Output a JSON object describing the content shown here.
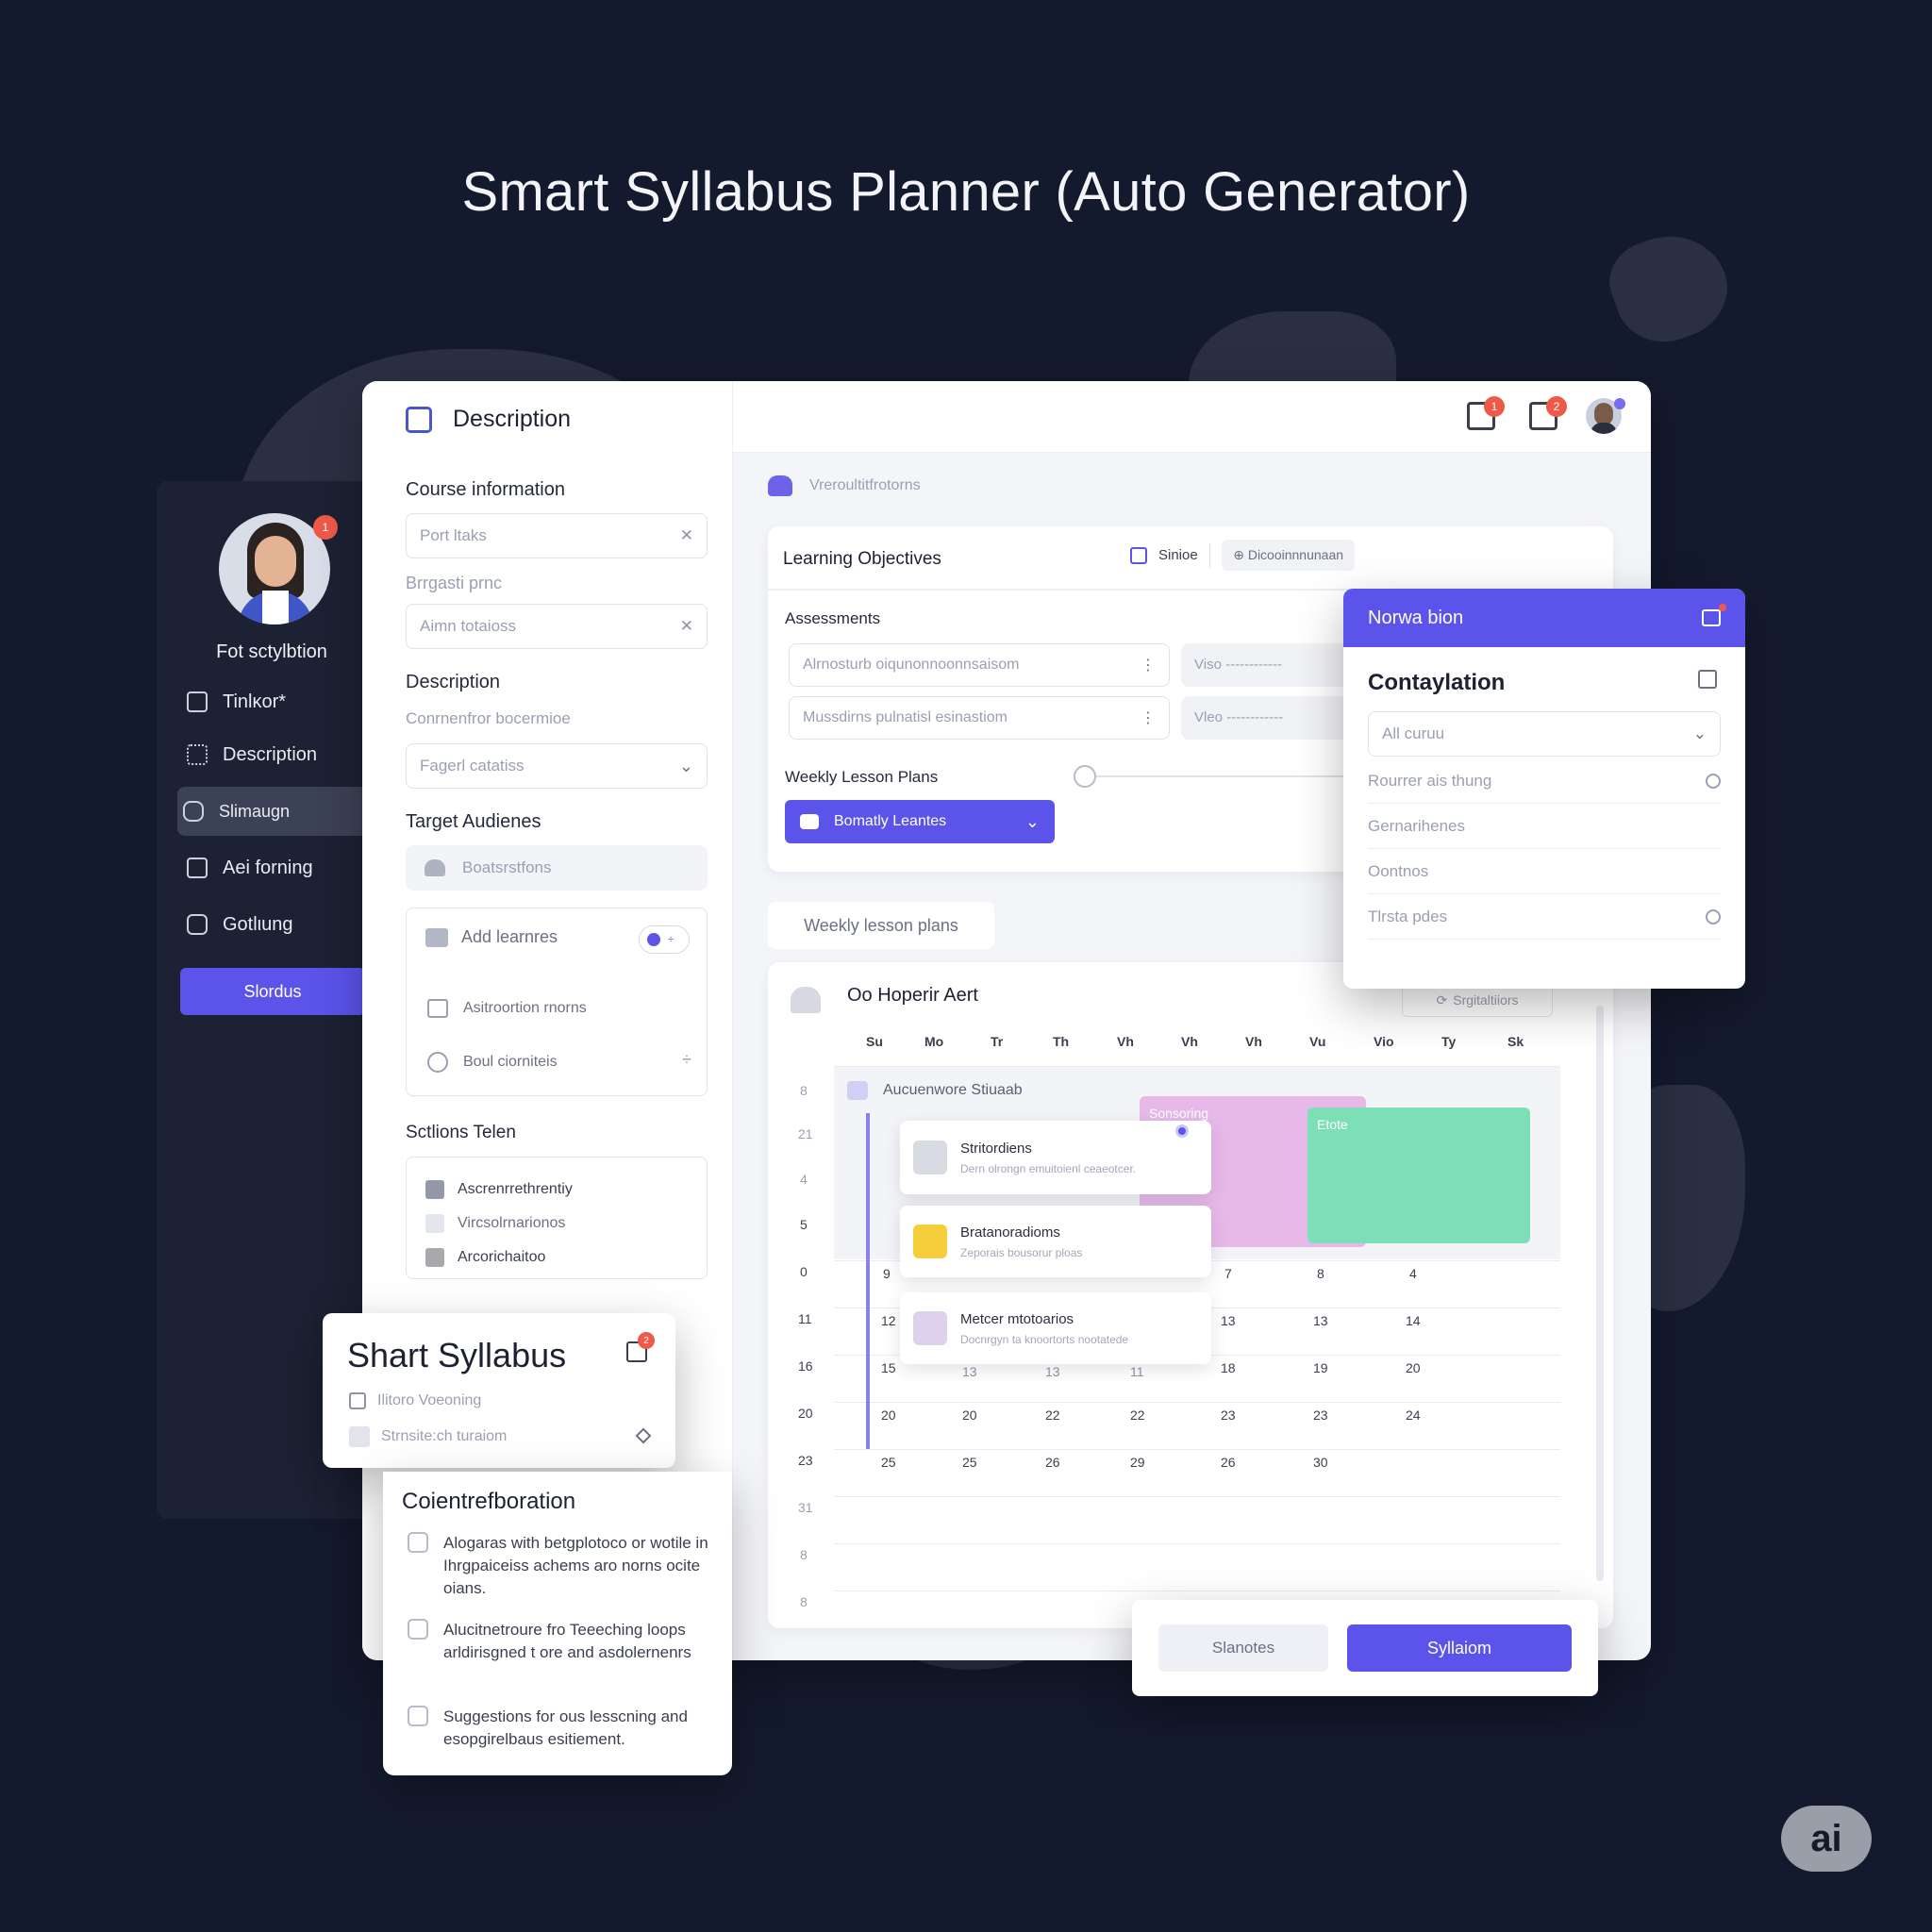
{
  "title": "Smart Syllabus Planner (Auto Generator)",
  "sidebar": {
    "user_name": "Fot sctylbtion",
    "items": [
      {
        "label": "Tinlκor*",
        "icon": "grid-icon"
      },
      {
        "label": "Description",
        "icon": "apps-icon"
      },
      {
        "label": "Slimaugn",
        "icon": "chat-icon"
      },
      {
        "label": "Aei forning",
        "icon": "briefcase-icon"
      },
      {
        "label": "Gotlιung",
        "icon": "camera-icon"
      }
    ],
    "button_label": "Slordus",
    "badge": "1"
  },
  "description_panel": {
    "header": "Description",
    "course_info_label": "Course information",
    "field1_placeholder": "Port ltaks",
    "sub_label": "Brrgasti prnc",
    "field2_placeholder": "Aimn totaioss",
    "description_label": "Description",
    "description_sub": "Conrnenfror bocermioe",
    "select_value": "Fagerl catatiss",
    "target_label": "Target Audienes",
    "target_item": "Boatsrstfons",
    "add_learners": "Add learnres",
    "action1": "Asitroortion rnorns",
    "action2": "Boul ciorniteis",
    "sections_label": "Sctlions Telen",
    "sections": [
      "Ascrenrrethrentiy",
      "Vircsolrnarionos",
      "Arcorichaitoo"
    ]
  },
  "shart_card": {
    "title": "Shart Syllabus",
    "item1": "Ilitoro Voeoning",
    "item2": "Strnsite:ch turaiom",
    "badge": "2"
  },
  "collab": {
    "title": "Coientrefboration",
    "items": [
      "Alogaras with betgplotoco or wotile in Ihrgpaiceiss achems aro norns ocite oians.",
      "Alucitnetroure fro Teeeching loops arldirisgned t ore and asdolernenrs",
      "Suggestions for ous lesscning and esopgirelbaus esitiement."
    ]
  },
  "topbar": {
    "badge1": "1",
    "badge2": "2"
  },
  "main": {
    "section_label": "Vreroultitfrotorns",
    "objectives_label": "Learning Objectives",
    "tool1": "Sinioe",
    "tool2": "Dicooinnnunaan",
    "assessments_label": "Assessments",
    "assess1": "Alrnosturb oiqunonnoonnsaisom",
    "assess2": "Mussdirns pulnatisl esinastiom",
    "view1": "Viso",
    "view2": "Vleo",
    "weekly_label": "Weekly Lesson Plans",
    "weekly_button": "Bomatly Leantes",
    "weekly_tab": "Weekly lesson plans"
  },
  "calendar": {
    "title": "Oo Hoperir Aert",
    "chip": "Srgitaltiiors",
    "days": [
      "Su",
      "Mo",
      "Tr",
      "Th",
      "Vh",
      "Vh",
      "Vh",
      "Vu",
      "Vio",
      "Ty",
      "Sk"
    ],
    "left_nums": [
      "8",
      "21",
      "4",
      "5",
      "0",
      "11",
      "16",
      "20",
      "23",
      "31",
      "8",
      "8"
    ],
    "banner": "Aucuenwore Stiuaab",
    "pink_label": "Sonsoring",
    "green_label": "Etote",
    "grid": [
      [
        "9",
        "7",
        "8",
        "4"
      ],
      [
        "12",
        "13",
        "13",
        "14"
      ],
      [
        "15",
        "18",
        "19",
        "20"
      ],
      [
        "20",
        "20",
        "22",
        "22",
        "23",
        "23",
        "24"
      ],
      [
        "25",
        "25",
        "26",
        "29",
        "26",
        "30"
      ]
    ],
    "grid_hidden": [
      "13",
      "13",
      "11"
    ],
    "events": [
      {
        "title": "Stritordiens",
        "sub": "Dern olrongn emuitoienl ceaeotcer.",
        "color": "#d9dbe3"
      },
      {
        "title": "Bratanoradioms",
        "sub": "Zeporais bousorur ploas",
        "color": "#f6cd3b"
      },
      {
        "title": "Metcer mtotoarios",
        "sub": "Docnrgyn ta knoortorts nootatede",
        "color": "#ddd1ee"
      }
    ]
  },
  "right_panel": {
    "header": "Norwa bion",
    "title": "Contaylation",
    "select": "All curuu",
    "items": [
      "Rourrer ais thung",
      "Gernarihenes",
      "Oontnos",
      "Tlrsta pdes"
    ]
  },
  "footer": {
    "secondary": "Slanotes",
    "primary": "Syllaiom"
  },
  "fab": "ai",
  "colors": {
    "accent": "#5b53ea",
    "background": "#141a2d",
    "sidebar": "#1c2133",
    "pink": "#e7b9e9",
    "green": "#7ddfb6",
    "badge": "#ef5a48"
  }
}
